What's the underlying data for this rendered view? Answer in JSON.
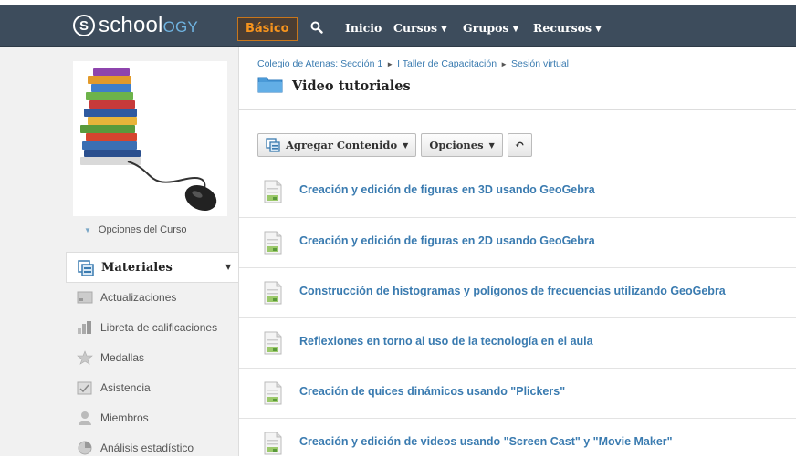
{
  "nav": {
    "brand_prefix": "school",
    "brand_suffix": "ogy",
    "logo_letter": "S",
    "basic_label": "Básico",
    "links": [
      {
        "label": "Inicio"
      },
      {
        "label": "Cursos"
      },
      {
        "label": "Grupos"
      },
      {
        "label": "Recursos"
      }
    ],
    "colors": {
      "bar": "#3d4c5c",
      "accent": "#f7941d",
      "link": "#3a7bb0"
    }
  },
  "sidebar": {
    "course_options": "Opciones del Curso",
    "active_item": "Materiales",
    "items": [
      {
        "label": "Actualizaciones",
        "icon": "updates-icon"
      },
      {
        "label": "Libreta de calificaciones",
        "icon": "gradebook-icon"
      },
      {
        "label": "Medallas",
        "icon": "badges-icon"
      },
      {
        "label": "Asistencia",
        "icon": "attendance-icon"
      },
      {
        "label": "Miembros",
        "icon": "members-icon"
      },
      {
        "label": "Análisis estadístico",
        "icon": "analytics-icon"
      }
    ]
  },
  "breadcrumb": {
    "items": [
      "Colegio de Atenas: Sección 1",
      "I Taller de Capacitación",
      "Sesión virtual"
    ]
  },
  "folder": {
    "title": "Video tutoriales"
  },
  "toolbar": {
    "add_content": "Agregar Contenido",
    "options": "Opciones"
  },
  "materials": [
    {
      "title": "Creación y edición de figuras en 3D usando GeoGebra"
    },
    {
      "title": "Creación y edición de figuras en 2D usando GeoGebra"
    },
    {
      "title": "Construcción de histogramas y polígonos de frecuencias utilizando GeoGebra"
    },
    {
      "title": "Reflexiones en torno al uso de la tecnología en el aula"
    },
    {
      "title": "Creación de quices dinámicos usando \"Plickers\""
    },
    {
      "title": "Creación y edición de videos usando \"Screen Cast\" y \"Movie Maker\""
    }
  ]
}
